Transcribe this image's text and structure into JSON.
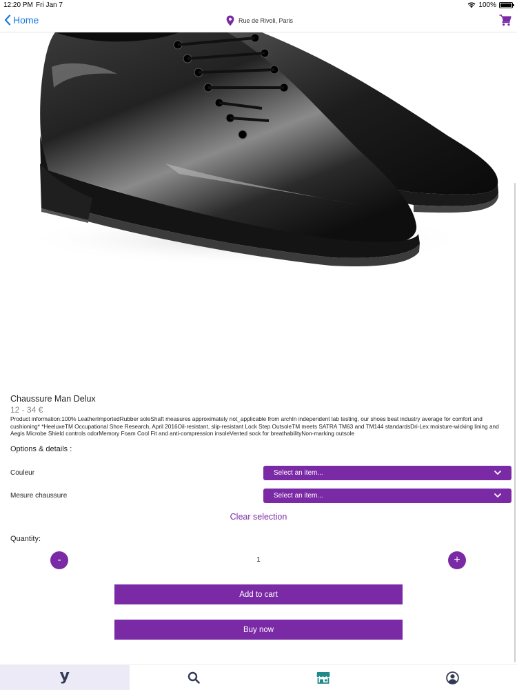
{
  "status_bar": {
    "time": "12:20 PM",
    "date": "Fri Jan 7",
    "battery": "100%",
    "wifi_icon": "wifi-icon",
    "battery_icon": "battery-icon"
  },
  "nav": {
    "back_label": "Home",
    "location": "Rue de Rivoli, Paris",
    "back_icon": "chevron-left-icon",
    "location_icon": "map-pin-icon",
    "cart_icon": "cart-icon"
  },
  "product": {
    "title": "Chaussure Man Delux",
    "price": "12 - 34 €",
    "description": "Product information:100% LeatherImportedRubber soleShaft measures approximately not_applicable from archIn independent lab testing, our shoes beat industry average for comfort and cushioning* *HeeluxeTM Occupational Shoe Research, April 2016Oil-resistant, slip-resistant Lock Step OutsoleTM meets SATRA TM63 and TM144 standardsDri-Lex moisture-wicking lining and Aegis Microbe Shield controls odorMemory Foam Cool Fit and anti-compression insoleVented sock for breathabilityNon-marking outsole"
  },
  "options": {
    "heading": "Options & details :",
    "items": [
      {
        "label": "Couleur",
        "value": "Select an item..."
      },
      {
        "label": "Mesure chaussure",
        "value": "Select an item..."
      }
    ],
    "clear_label": "Clear selection"
  },
  "quantity": {
    "label": "Quantity:",
    "value": "1",
    "minus_label": "-",
    "plus_label": "+"
  },
  "actions": {
    "add_to_cart": "Add to cart",
    "buy_now": "Buy now"
  },
  "tab_bar": {
    "tabs": [
      {
        "name": "home",
        "icon": "y-logo-icon",
        "glyph": "y",
        "active": true
      },
      {
        "name": "search",
        "icon": "search-icon",
        "active": false
      },
      {
        "name": "store",
        "icon": "store-icon",
        "active": false
      },
      {
        "name": "account",
        "icon": "user-circle-icon",
        "active": false
      }
    ]
  },
  "colors": {
    "accent": "#7b2aa6",
    "link": "#1a7be0",
    "active_tab_bg": "#eceaf7",
    "icon_dark": "#333a55",
    "store_icon": "#1f8a8a"
  }
}
